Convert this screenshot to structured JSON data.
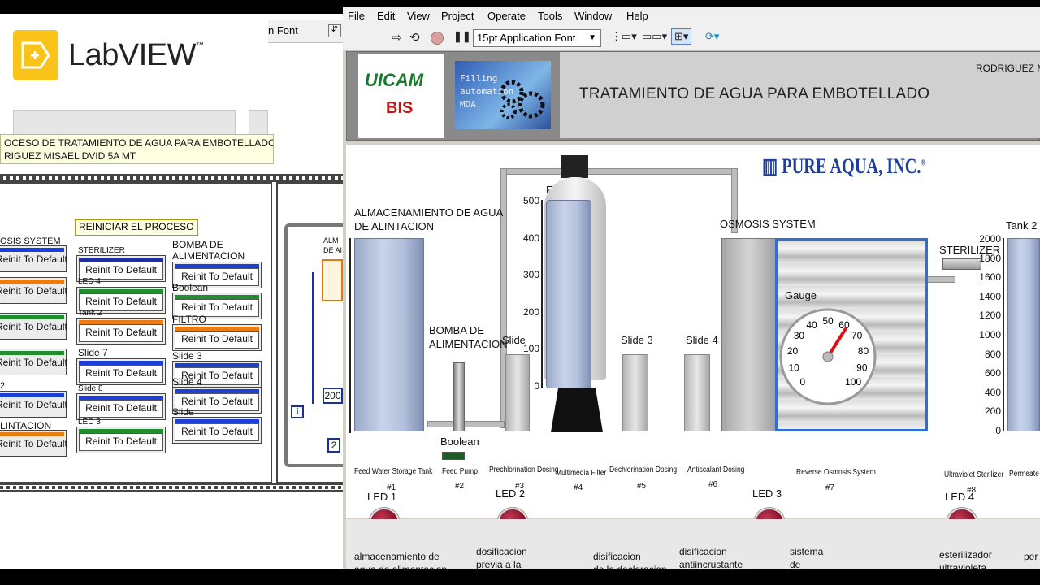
{
  "left_window": {
    "logo_text": "LabVIEW",
    "logo_tm": "™",
    "font_partial": "n Font",
    "comment_line1": "OCESO DE TRATAMIENTO DE AGUA PARA EMBOTELLADO",
    "comment_line2": "RIGUEZ MISAEL DVID  5A MT",
    "reset_label": "REINICIAR EL PROCESO",
    "col1_labels": [
      "OSIS SYSTEM",
      "",
      "",
      "",
      "2",
      "LINTACION"
    ],
    "col2_labels": [
      "STERILIZER",
      "LED 4",
      "Tank 2",
      "Slide 7",
      "Slide 8",
      "LED 3"
    ],
    "col3_labels": [
      "BOMBA DE ALIMENTACION",
      "Boolean",
      "FILTRO",
      "Slide 3",
      "Slide 4",
      "Slide"
    ],
    "reinit_label": "Reinit To Default",
    "loop_values": [
      "200",
      "2"
    ],
    "loop_label_partial": "ALM DE AI",
    "i_label": "i"
  },
  "menu": [
    "File",
    "Edit",
    "View",
    "Project",
    "Operate",
    "Tools",
    "Window",
    "Help"
  ],
  "toolbar": {
    "font": "15pt Application Font"
  },
  "header": {
    "logo1_top": "UICAM",
    "logo1_bottom": "BIS",
    "logo2_lines": [
      "Filling",
      "automation",
      "MDA"
    ],
    "title": "TRATAMIENTO DE AGUA PARA EMBOTELLADO",
    "author": "RODRIGUEZ M"
  },
  "scene": {
    "brand": "PURE AQUA, INC.",
    "brand_mark": "®",
    "labels": {
      "storage": [
        "ALMACENAMIENTO DE AGUA",
        "DE ALINTACION"
      ],
      "pump": [
        "BOMBA DE",
        "ALIMENTACION"
      ],
      "filter": "FILTRO",
      "osmosis": "OSMOSIS SYSTEM",
      "sterilizer": "STERILIZER",
      "tank2": "Tank 2",
      "gauge": "Gauge",
      "boolean": "Boolean",
      "slide": "Slide",
      "slide3": "Slide 3",
      "slide4": "Slide 4"
    },
    "filter_scale": [
      "500",
      "400",
      "300",
      "200",
      "100",
      "0"
    ],
    "tank2_scale": [
      "2000",
      "1800",
      "1600",
      "1400",
      "1200",
      "1000",
      "800",
      "600",
      "400",
      "200",
      "0"
    ],
    "gauge_ticks": [
      "0",
      "10",
      "20",
      "30",
      "40",
      "50",
      "60",
      "70",
      "80",
      "90",
      "100"
    ],
    "gauge_value": 62,
    "captions": [
      {
        "text": "Feed Water Storage Tank",
        "num": "#1"
      },
      {
        "text": "Feed Pump",
        "num": "#2"
      },
      {
        "text": "Prechlorination Dosing",
        "num": "#3"
      },
      {
        "text": "Multimedia Filter",
        "num": "#4"
      },
      {
        "text": "Dechlorination Dosing",
        "num": "#5"
      },
      {
        "text": "Antiscalant Dosing",
        "num": "#6"
      },
      {
        "text": "Reverse Osmosis System",
        "num": "#7"
      },
      {
        "text": "Ultraviolet Sterilizer",
        "num": "#8"
      },
      {
        "text": "Permeate W",
        "num": ""
      }
    ]
  },
  "leds": [
    "LED 1",
    "LED 2",
    "LED 3",
    "LED 4"
  ],
  "descriptions": [
    [
      "almacenamiento de",
      "agua de alimentacion"
    ],
    [
      "dosificacion",
      "previa a la"
    ],
    [
      "disificacion",
      "de la decloracion"
    ],
    [
      "disificacion",
      "antiincrustante"
    ],
    [
      "sistema",
      "de"
    ],
    [
      "esterilizador",
      "ultravioleta"
    ],
    [
      "per",
      ""
    ]
  ],
  "colors": {
    "led": "#8b1024",
    "bar_blue": "#1c3fd6",
    "bar_orange": "#ea7d12",
    "bar_green": "#1e8f2c",
    "header_bg": "#8a8a8a"
  }
}
